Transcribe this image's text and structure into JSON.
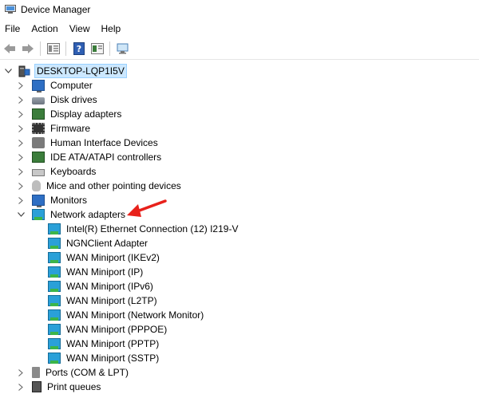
{
  "window": {
    "title": "Device Manager"
  },
  "menu": [
    "File",
    "Action",
    "View",
    "Help"
  ],
  "toolbar": [
    "back-icon",
    "forward-icon",
    "properties-icon",
    "help-icon",
    "update-driver-icon",
    "scan-hardware-icon"
  ],
  "root": {
    "label": "DESKTOP-LQP1I5V",
    "expanded": true
  },
  "categories": [
    {
      "label": "Computer",
      "icon": "computer-icon"
    },
    {
      "label": "Disk drives",
      "icon": "disk-drive-icon"
    },
    {
      "label": "Display adapters",
      "icon": "display-adapter-icon"
    },
    {
      "label": "Firmware",
      "icon": "firmware-icon"
    },
    {
      "label": "Human Interface Devices",
      "icon": "hid-icon"
    },
    {
      "label": "IDE ATA/ATAPI controllers",
      "icon": "ide-controller-icon"
    },
    {
      "label": "Keyboards",
      "icon": "keyboard-icon"
    },
    {
      "label": "Mice and other pointing devices",
      "icon": "mouse-icon"
    },
    {
      "label": "Monitors",
      "icon": "monitor-icon"
    },
    {
      "label": "Network adapters",
      "icon": "network-adapter-icon",
      "expanded": true
    }
  ],
  "network_adapters": [
    "Intel(R) Ethernet Connection (12) I219-V",
    "NGNClient Adapter",
    "WAN Miniport (IKEv2)",
    "WAN Miniport (IP)",
    "WAN Miniport (IPv6)",
    "WAN Miniport (L2TP)",
    "WAN Miniport (Network Monitor)",
    "WAN Miniport (PPPOE)",
    "WAN Miniport (PPTP)",
    "WAN Miniport (SSTP)"
  ],
  "after": [
    {
      "label": "Ports (COM & LPT)",
      "icon": "port-icon"
    },
    {
      "label": "Print queues",
      "icon": "printer-icon"
    }
  ],
  "annotation": {
    "type": "red-arrow",
    "color": "#e8211b",
    "target": "Network adapters"
  }
}
